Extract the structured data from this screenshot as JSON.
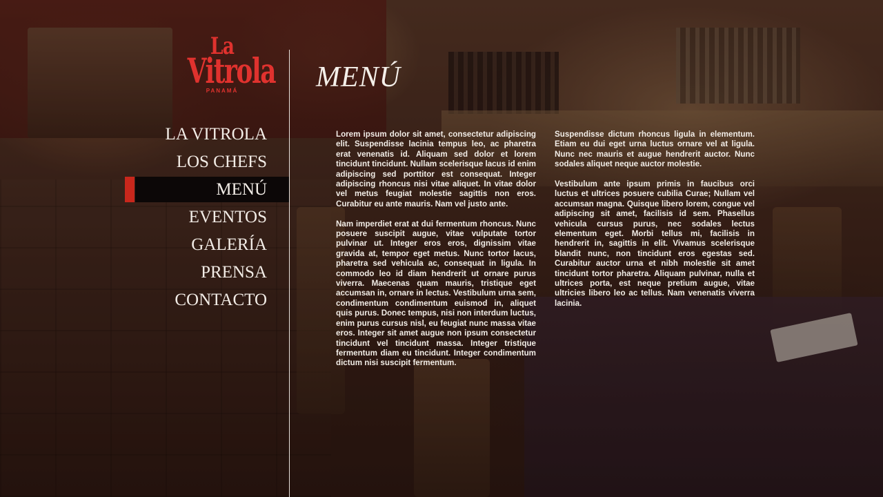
{
  "brand": {
    "name_line1": "La",
    "name_line2": "Vitrola",
    "location": "PANAMÁ",
    "accent_color": "#e0322e"
  },
  "nav": {
    "items": [
      {
        "label": "LA VITROLA",
        "active": false
      },
      {
        "label": "LOS CHEFS",
        "active": false
      },
      {
        "label": "MENÚ",
        "active": true
      },
      {
        "label": "EVENTOS",
        "active": false
      },
      {
        "label": "GALERÍA",
        "active": false
      },
      {
        "label": "PRENSA",
        "active": false
      },
      {
        "label": "CONTACTO",
        "active": false
      }
    ],
    "active_marker_color": "#c8271c"
  },
  "main": {
    "title": "MENÚ",
    "column1": [
      "Lorem ipsum dolor sit amet, consectetur adipiscing elit. Suspendisse lacinia tempus leo, ac pharetra erat venenatis id. Aliquam sed dolor et lorem tincidunt tincidunt. Nullam scelerisque lacus id enim adipiscing sed porttitor est consequat. Integer adipiscing rhoncus nisi vitae aliquet. In vitae dolor vel metus feugiat molestie sagittis non eros. Curabitur eu ante mauris. Nam vel justo ante.",
      "Nam imperdiet erat at dui fermentum rhoncus. Nunc posuere suscipit augue, vitae vulputate tortor pulvinar ut. Integer eros eros, dignissim vitae gravida at, tempor eget metus. Nunc tortor lacus, pharetra sed vehicula ac, consequat in ligula. In commodo leo id diam hendrerit ut ornare purus viverra. Maecenas quam mauris, tristique eget accumsan in, ornare in lectus. Vestibulum urna sem, condimentum condimentum euismod in, aliquet quis purus. Donec tempus, nisi non interdum luctus, enim purus cursus nisl, eu feugiat nunc massa vitae eros. Integer sit amet augue non ipsum consectetur tincidunt vel tincidunt massa. Integer tristique fermentum diam eu tincidunt. Integer condimentum dictum nisi suscipit fermentum."
    ],
    "column2": [
      "Suspendisse dictum rhoncus ligula in elementum. Etiam eu dui eget urna luctus ornare vel at ligula. Nunc nec mauris et augue hendrerit auctor. Nunc sodales aliquet neque auctor molestie.",
      "Vestibulum ante ipsum primis in faucibus orci luctus et ultrices posuere cubilia Curae; Nullam vel accumsan magna. Quisque libero lorem, congue vel adipiscing sit amet, facilisis id sem. Phasellus vehicula cursus purus, nec sodales lectus elementum eget. Morbi tellus mi, facilisis in hendrerit in, sagittis in elit. Vivamus scelerisque blandit nunc, non tincidunt eros egestas sed. Curabitur auctor urna et nibh molestie sit amet tincidunt tortor pharetra. Aliquam pulvinar, nulla et ultrices porta, est neque pretium augue, vitae ultricies libero leo ac tellus. Nam venenatis viverra lacinia."
    ]
  }
}
